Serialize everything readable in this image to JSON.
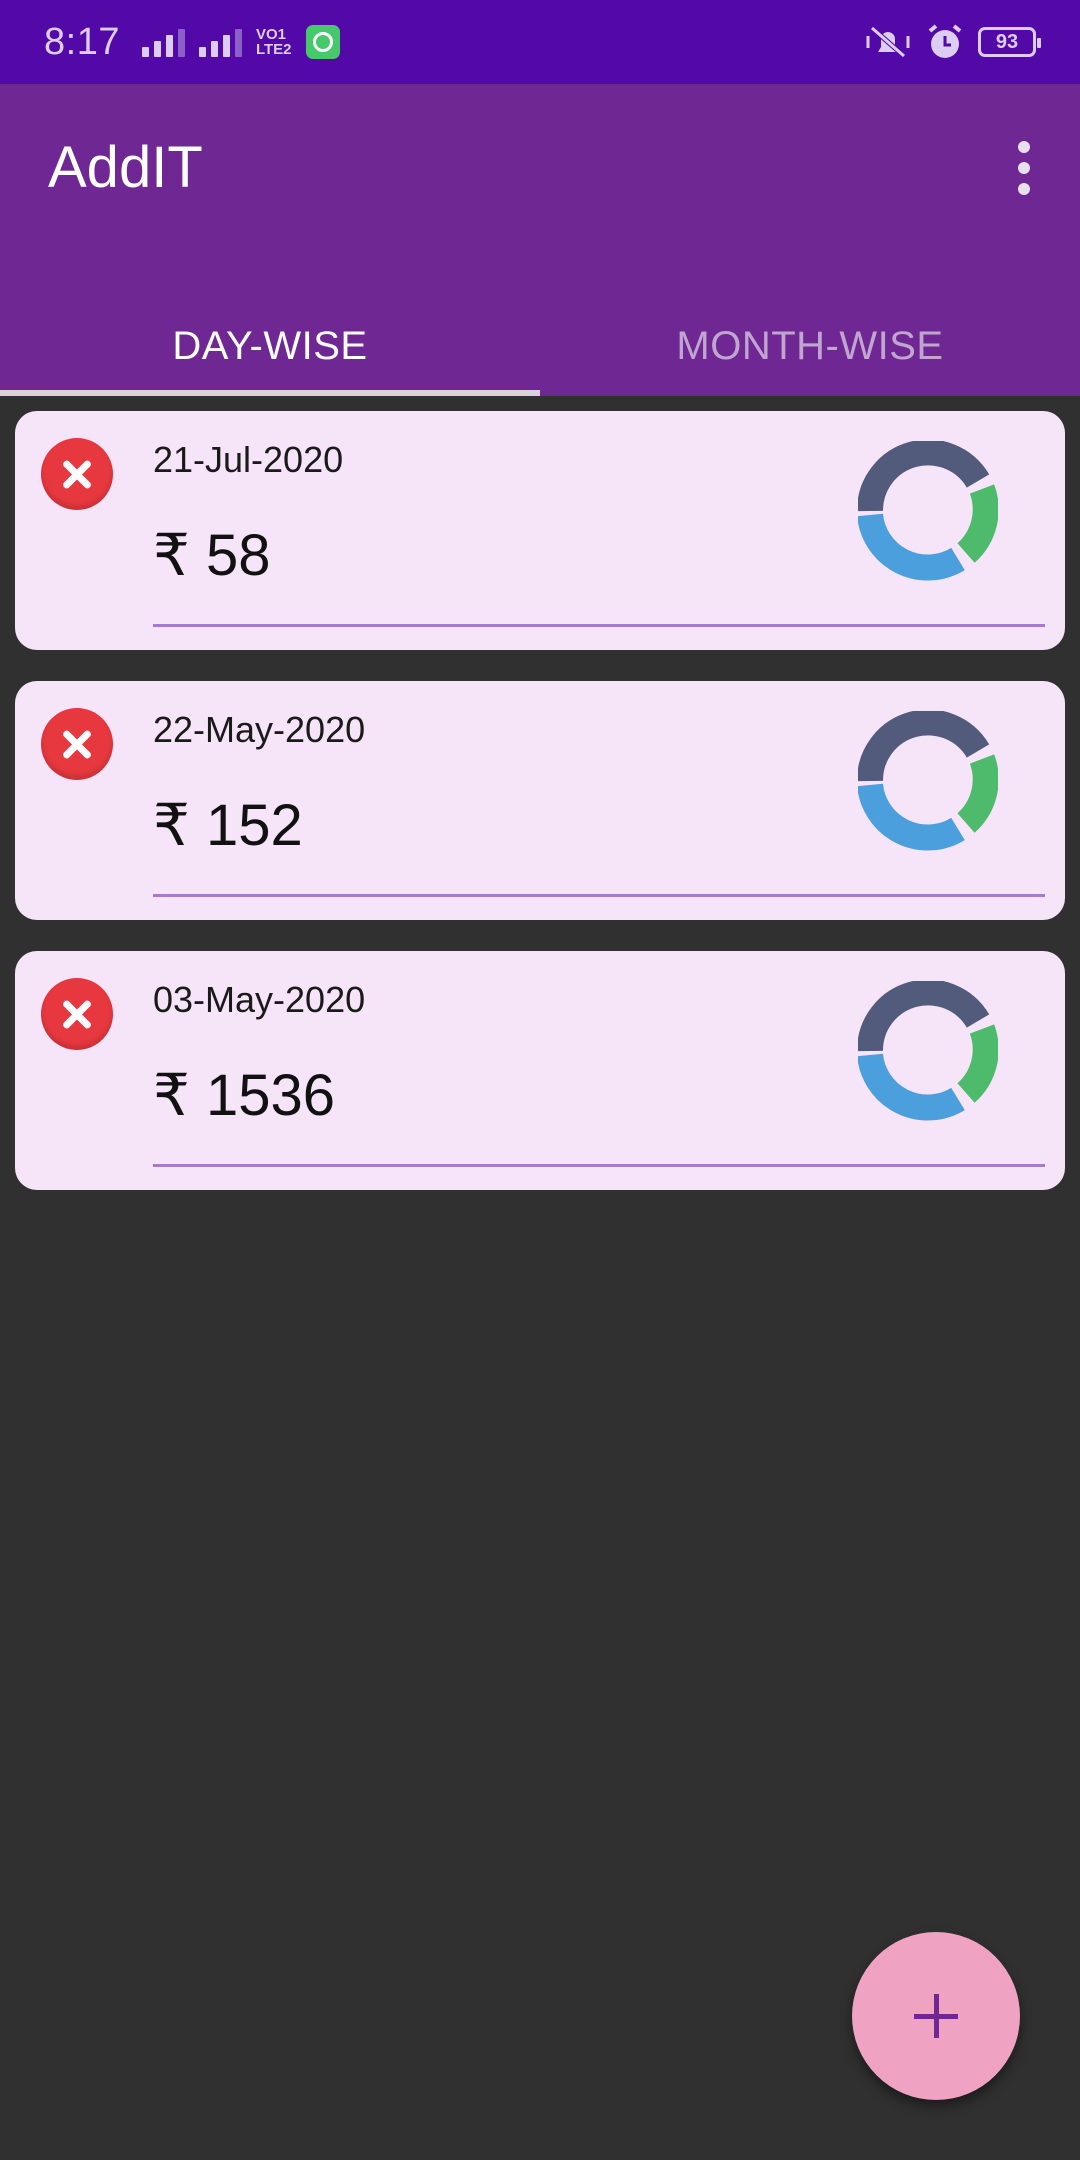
{
  "status_bar": {
    "time": "8:17",
    "network_label_1": "VO1",
    "network_label_2": "LTE2",
    "battery": "93",
    "icons": [
      "signal-icon",
      "signal-icon",
      "volte-icon",
      "app-notification-icon",
      "mute-icon",
      "alarm-icon",
      "battery-icon"
    ]
  },
  "app_bar": {
    "title": "AddIT",
    "menu_icon": "more-vert-icon"
  },
  "tabs": [
    {
      "label": "DAY-WISE",
      "active": true
    },
    {
      "label": "MONTH-WISE",
      "active": false
    }
  ],
  "entries": [
    {
      "date": "21-Jul-2020",
      "amount": "₹ 58"
    },
    {
      "date": "22-May-2020",
      "amount": "₹ 152"
    },
    {
      "date": "03-May-2020",
      "amount": "₹ 1536"
    }
  ],
  "colors": {
    "status_bar": "#5209a8",
    "app_bar": "#6f2794",
    "background": "#303030",
    "card": "#f6e4f9",
    "delete": "#e8383f",
    "fab": "#efa2c1",
    "ring_dark": "#525b7b",
    "ring_blue": "#4a9fdc",
    "ring_green": "#4dbb6b"
  },
  "fab": {
    "icon": "add-icon"
  }
}
